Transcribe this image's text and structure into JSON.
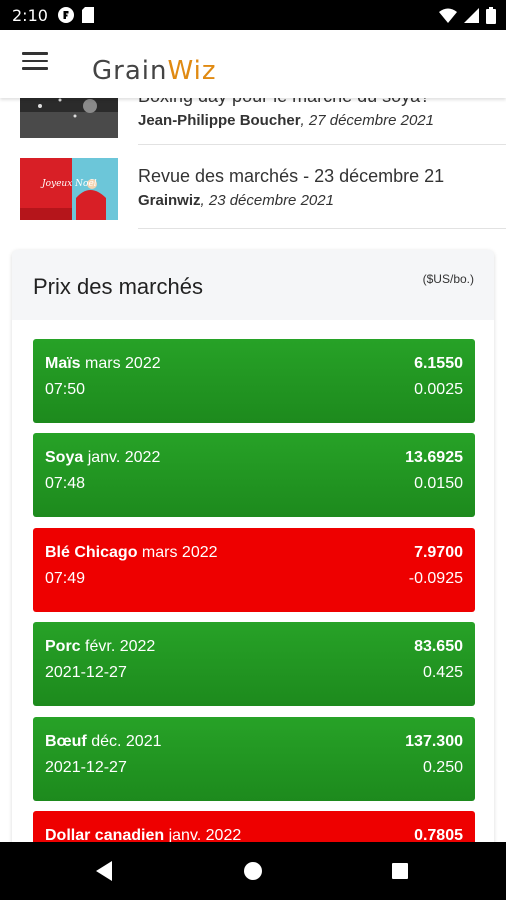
{
  "status_bar": {
    "time": "2:10"
  },
  "app": {
    "logo_prefix": "Grain",
    "logo_suffix": "Wiz"
  },
  "news": [
    {
      "title": "Boxing day pour le marché du soya?",
      "author": "Jean-Philippe Boucher",
      "date": ", 27 décembre 2021"
    },
    {
      "title": "Revue des marchés - 23 décembre 21",
      "author": "Grainwiz",
      "date": ", 23 décembre 2021",
      "thumb_text": "Joyeux Noël"
    }
  ],
  "market": {
    "title": "Prix des marchés",
    "unit": "($US/bo.)",
    "rows": [
      {
        "name": "Maïs",
        "contract": " mars 2022",
        "time": "07:50",
        "price": "6.1550",
        "change": "0.0025",
        "trend": "up"
      },
      {
        "name": "Soya",
        "contract": " janv. 2022",
        "time": "07:48",
        "price": "13.6925",
        "change": "0.0150",
        "trend": "up"
      },
      {
        "name": "Blé Chicago",
        "contract": " mars 2022",
        "time": "07:49",
        "price": "7.9700",
        "change": "-0.0925",
        "trend": "down"
      },
      {
        "name": "Porc",
        "contract": " févr. 2022",
        "time": "2021-12-27",
        "price": "83.650",
        "change": "0.425",
        "trend": "up"
      },
      {
        "name": "Bœuf",
        "contract": " déc. 2021",
        "time": "2021-12-27",
        "price": "137.300",
        "change": "0.250",
        "trend": "up"
      },
      {
        "name": "Dollar canadien",
        "contract": " janv. 2022",
        "time": "",
        "price": "0.7805",
        "change": "",
        "trend": "down"
      }
    ]
  },
  "colors": {
    "up": "#1f8f1f",
    "down": "#ee0000",
    "accent": "#e08a12"
  },
  "icons": [
    "menu-icon",
    "wifi-icon",
    "signal-icon",
    "battery-icon",
    "back-icon",
    "home-icon",
    "recents-icon"
  ]
}
